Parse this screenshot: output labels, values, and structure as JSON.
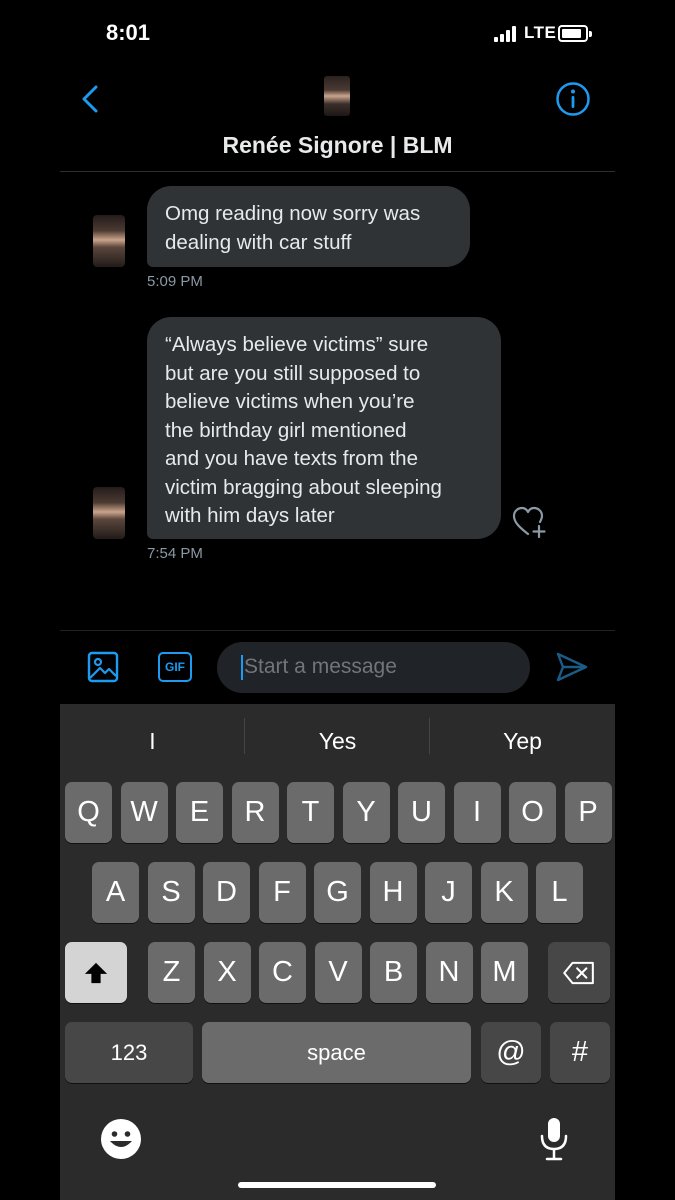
{
  "status_bar": {
    "time": "8:01",
    "network": "LTE"
  },
  "header": {
    "title": "Renée Signore | BLM"
  },
  "messages": [
    {
      "lines": [
        "Omg reading now sorry was",
        "dealing with car stuff"
      ],
      "time": "5:09 PM"
    },
    {
      "lines": [
        "“Always believe victims” sure",
        "but are you still supposed to",
        "believe victims when you’re",
        "the birthday girl mentioned",
        "and you have texts from the",
        "victim bragging about sleeping",
        "with him days later"
      ],
      "time": "7:54 PM"
    }
  ],
  "compose": {
    "gif_label": "GIF",
    "placeholder": "Start a message"
  },
  "keyboard": {
    "suggestions": [
      "I",
      "Yes",
      "Yep"
    ],
    "row1": [
      "Q",
      "W",
      "E",
      "R",
      "T",
      "Y",
      "U",
      "I",
      "O",
      "P"
    ],
    "row2": [
      "A",
      "S",
      "D",
      "F",
      "G",
      "H",
      "J",
      "K",
      "L"
    ],
    "row3": [
      "Z",
      "X",
      "C",
      "V",
      "B",
      "N",
      "M"
    ],
    "numbers_label": "123",
    "space_label": "space",
    "at_label": "@",
    "hash_label": "#"
  },
  "colors": {
    "accent": "#1d9bf0",
    "bubble": "#2f3336",
    "background": "#000000"
  },
  "icons": [
    "back-icon",
    "info-icon",
    "like-add-icon",
    "media-icon",
    "gif-icon",
    "send-icon",
    "shift-icon",
    "delete-icon",
    "emoji-icon",
    "mic-icon"
  ]
}
